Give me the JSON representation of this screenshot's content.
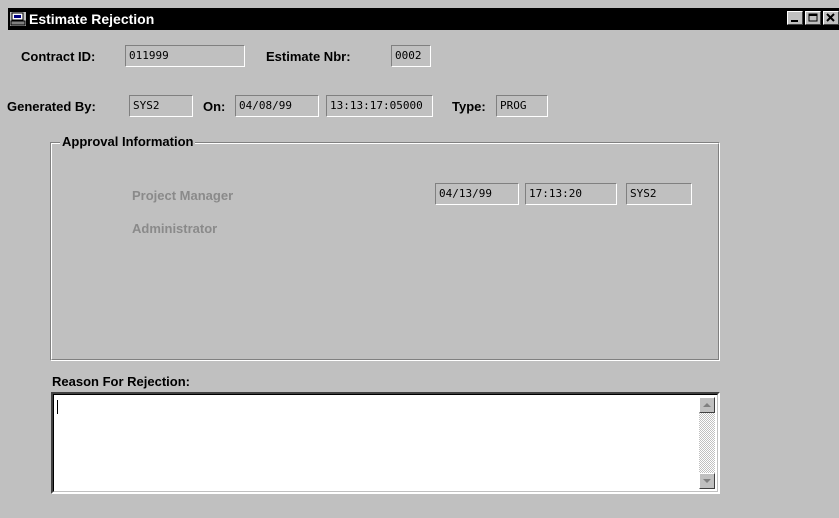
{
  "window": {
    "title": "Estimate Rejection",
    "buttons": [
      "minimize-icon",
      "maximize-icon",
      "close-icon"
    ]
  },
  "header": {
    "contract_id_label": "Contract ID:",
    "contract_id_value": "011999",
    "estimate_nbr_label": "Estimate Nbr:",
    "estimate_nbr_value": "0002",
    "generated_by_label": "Generated By:",
    "generated_by_value": "SYS2",
    "on_label": "On:",
    "on_date_value": "04/08/99",
    "on_time_value": "13:13:17:05000",
    "type_label": "Type:",
    "type_value": "PROG"
  },
  "approval": {
    "group_title": "Approval Information",
    "rows": [
      {
        "role": "Project Manager",
        "date": "04/13/99",
        "time": "17:13:20",
        "user": "SYS2"
      },
      {
        "role": "Administrator"
      }
    ]
  },
  "reason": {
    "label": "Reason For Rejection:",
    "value": ""
  },
  "colors": {
    "face": "#c0c0c0",
    "titlebar": "#000000",
    "disabled_text": "#8a8a8a"
  }
}
